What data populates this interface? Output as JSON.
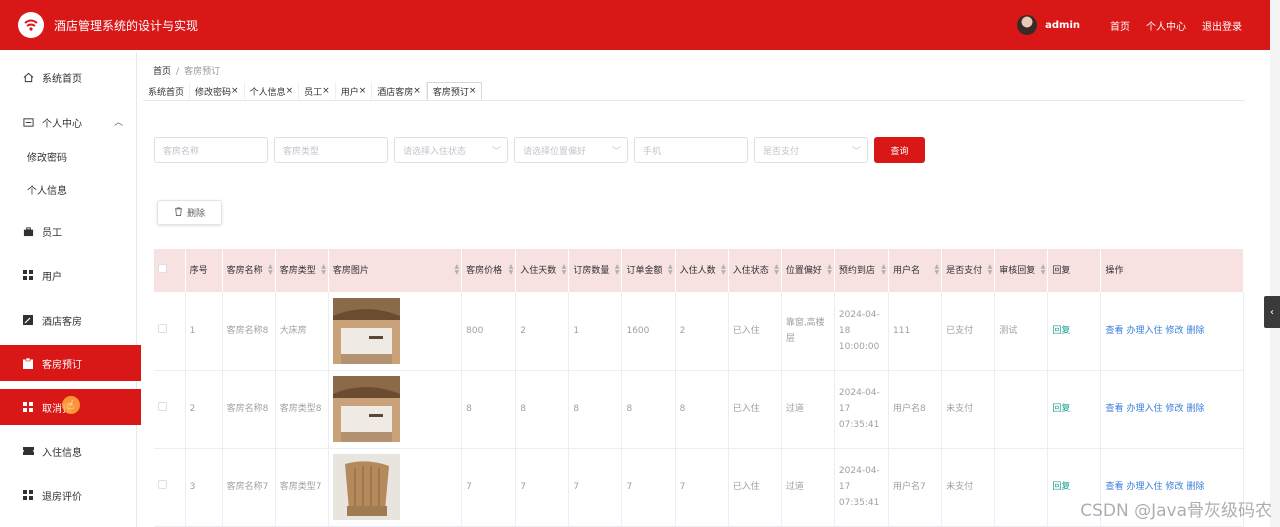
{
  "header": {
    "title": "酒店管理系统的设计与实现",
    "user": "admin",
    "links": [
      "首页",
      "个人中心",
      "退出登录"
    ],
    "accent": "#d91717"
  },
  "sidebar": {
    "items": [
      {
        "label": "系统首页",
        "icon": "home-icon"
      },
      {
        "label": "个人中心",
        "icon": "user-card-icon"
      },
      {
        "label": "修改密码",
        "icon": ""
      },
      {
        "label": "个人信息",
        "icon": ""
      },
      {
        "label": "员工",
        "icon": "briefcase-icon"
      },
      {
        "label": "用户",
        "icon": "grid-icon"
      },
      {
        "label": "酒店客房",
        "icon": "edit-icon"
      },
      {
        "label": "客房预订",
        "icon": "clipboard-icon"
      },
      {
        "label": "取消预",
        "icon": "grid-icon"
      },
      {
        "label": "入住信息",
        "icon": "ticket-icon"
      },
      {
        "label": "退房评价",
        "icon": "grid-icon"
      }
    ]
  },
  "breadcrumb": {
    "home": "首页",
    "sep": "/",
    "current": "客房预订"
  },
  "tabs": [
    {
      "label": "系统首页",
      "closable": false
    },
    {
      "label": "修改密码",
      "closable": true
    },
    {
      "label": "个人信息",
      "closable": true
    },
    {
      "label": "员工",
      "closable": true
    },
    {
      "label": "用户",
      "closable": true
    },
    {
      "label": "酒店客房",
      "closable": true
    },
    {
      "label": "客房预订",
      "closable": true
    }
  ],
  "filters": {
    "room_name": "客房名称",
    "room_type": "客房类型",
    "checkin_status": "请选择入住状态",
    "location_pref": "请选择位置偏好",
    "phone": "手机",
    "paid": "是否支付",
    "query_label": "查询"
  },
  "toolbar": {
    "delete_label": "删除"
  },
  "table": {
    "headers": [
      "序号",
      "客房名称",
      "客房类型",
      "客房图片",
      "客房价格",
      "入住天数",
      "订房数量",
      "订单金额",
      "入住人数",
      "入住状态",
      "位置偏好",
      "预约到店",
      "用户名",
      "是否支付",
      "审核回复",
      "回复",
      "操作"
    ],
    "rows": [
      {
        "no": "1",
        "name": "客房名称8",
        "type": "大床房",
        "image": "room-photo-1",
        "price": "800",
        "days": "2",
        "qty": "1",
        "amount": "1600",
        "people": "2",
        "status": "已入住",
        "pref": "靠窗,高楼层",
        "arrive": "2024-04-18 10:00:00",
        "user": "111",
        "paid": "已支付",
        "review": "测试",
        "reply": "回复"
      },
      {
        "no": "2",
        "name": "客房名称8",
        "type": "客房类型8",
        "image": "room-photo-1",
        "price": "8",
        "days": "8",
        "qty": "8",
        "amount": "8",
        "people": "8",
        "status": "已入住",
        "pref": "过道",
        "arrive": "2024-04-17 07:35:41",
        "user": "用户名8",
        "paid": "未支付",
        "review": "",
        "reply": "回复"
      },
      {
        "no": "3",
        "name": "客房名称7",
        "type": "客房类型7",
        "image": "room-photo-2",
        "price": "7",
        "days": "7",
        "qty": "7",
        "amount": "7",
        "people": "7",
        "status": "已入住",
        "pref": "过道",
        "arrive": "2024-04-17 07:35:41",
        "user": "用户名7",
        "paid": "未支付",
        "review": "",
        "reply": "回复"
      }
    ],
    "ops": [
      "查看",
      "办理入住",
      "修改",
      "删除"
    ]
  },
  "watermark": "CSDN @Java骨灰级码农"
}
